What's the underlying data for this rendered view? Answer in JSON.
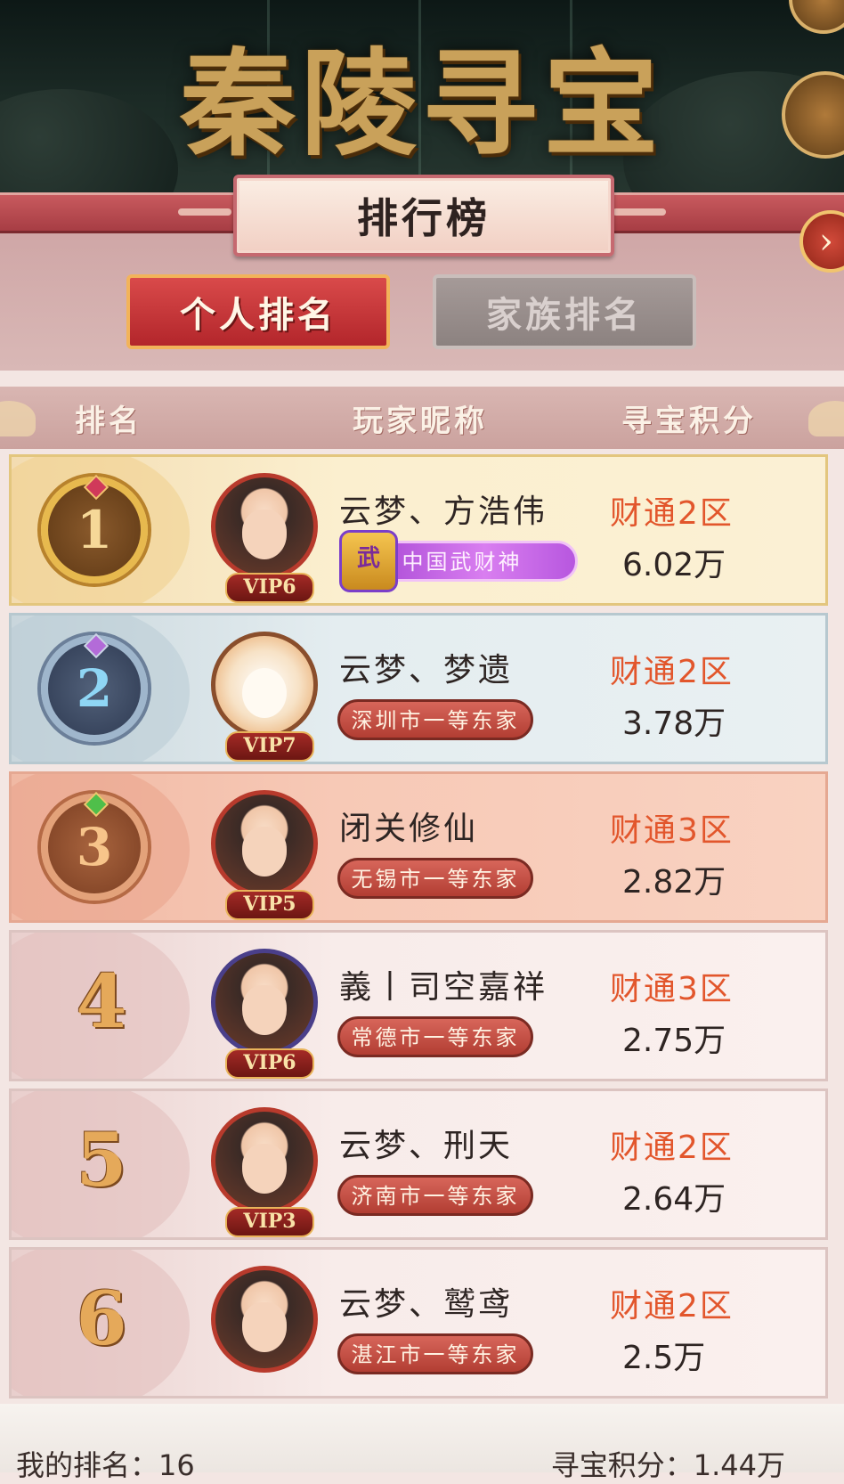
{
  "header": {
    "game_title": "秦陵寻宝",
    "panel_title": "排行榜",
    "back_button_icon": "chevron-right-icon"
  },
  "tabs": [
    {
      "label": "个人排名",
      "active": true
    },
    {
      "label": "家族排名",
      "active": false
    }
  ],
  "columns": {
    "rank": "排名",
    "nickname": "玩家昵称",
    "score": "寻宝积分"
  },
  "rows": [
    {
      "rank": "1",
      "vip": "VIP6",
      "name": "云梦、方浩伟",
      "title": "中国武财神",
      "emblem": "武",
      "server": "财通2区",
      "score": "6.02万"
    },
    {
      "rank": "2",
      "vip": "VIP7",
      "name": "云梦、梦遗",
      "title": "深圳市一等东家",
      "server": "财通2区",
      "score": "3.78万"
    },
    {
      "rank": "3",
      "vip": "VIP5",
      "name": "闭关修仙",
      "title": "无锡市一等东家",
      "server": "财通3区",
      "score": "2.82万"
    },
    {
      "rank": "4",
      "vip": "VIP6",
      "name": "義丨司空嘉祥",
      "title": "常德市一等东家",
      "server": "财通3区",
      "score": "2.75万"
    },
    {
      "rank": "5",
      "vip": "VIP3",
      "name": "云梦、刑天",
      "title": "济南市一等东家",
      "server": "财通2区",
      "score": "2.64万"
    },
    {
      "rank": "6",
      "vip": "",
      "name": "云梦、鹫鸢",
      "title": "湛江市一等东家",
      "server": "财通2区",
      "score": "2.5万"
    }
  ],
  "footer": {
    "my_rank_label": "我的排名：",
    "my_rank": "16",
    "my_score_label": "寻宝积分：",
    "my_score": "1.44万"
  },
  "colors": {
    "accent_red": "#b3262b",
    "server_orange": "#e2562c",
    "gold": "#c9a15a"
  }
}
